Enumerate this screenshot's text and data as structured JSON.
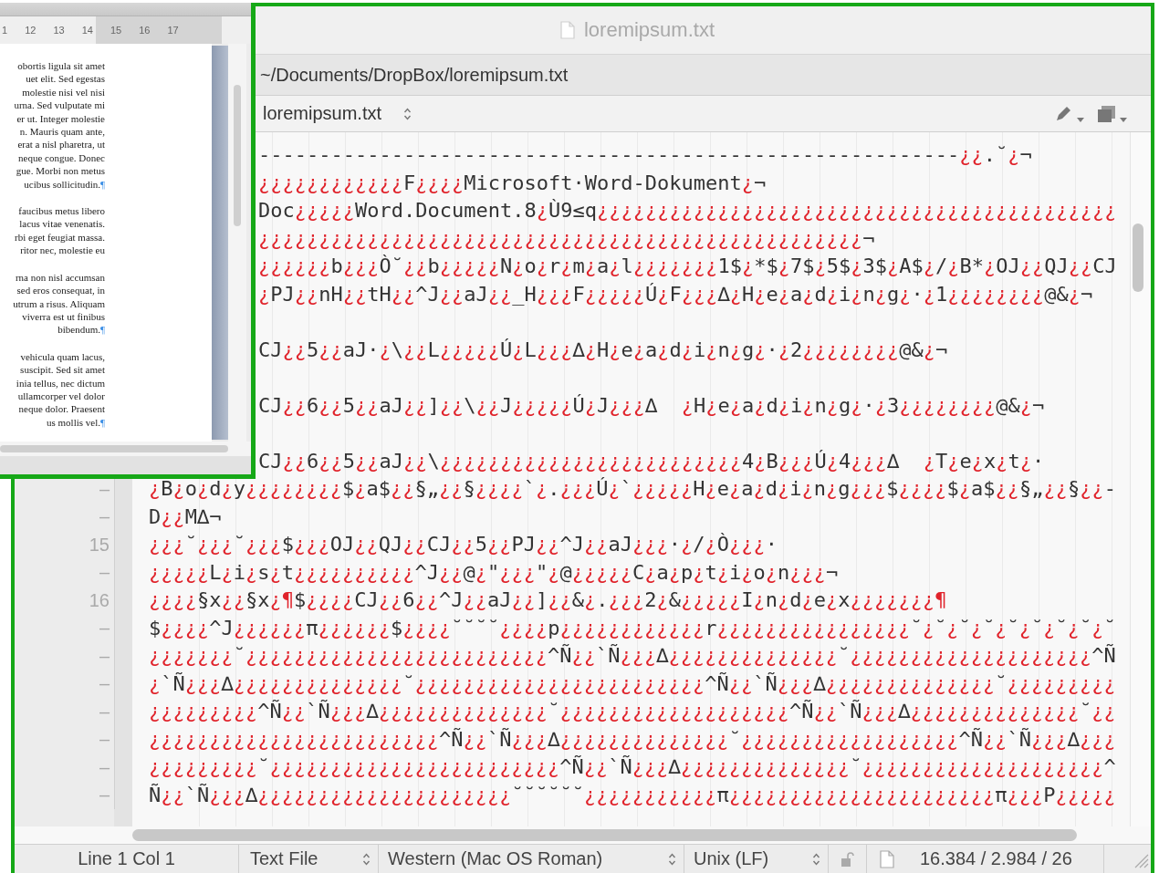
{
  "word_window": {
    "ruler_numbers": [
      "1",
      "12",
      "13",
      "14",
      "15",
      "16",
      "17"
    ],
    "paragraphs": [
      {
        "lines": [
          "obortis ligula sit amet",
          "uet elit. Sed egestas",
          "molestie nisi vel nisi",
          "urna. Sed vulputate mi",
          "er ut. Integer molestie",
          "n. Mauris quam ante,",
          "erat a nisl pharetra, ut",
          "neque congue. Donec",
          "gue. Morbi non metus",
          "ucibus sollicitudin."
        ],
        "end_mark": "¶"
      },
      {
        "lines": [
          "faucibus metus libero",
          "lacus vitae venenatis.",
          "rbi eget feugiat massa.",
          "ritor nec, molestie eu"
        ]
      },
      {
        "lines": [
          "rna non nisl accumsan",
          "sed eros consequat, in",
          "utrum a risus. Aliquam",
          "viverra est ut finibus",
          "bibendum."
        ],
        "end_mark": "¶"
      },
      {
        "lines": [
          "vehicula quam lacus,",
          "suscipit. Sed sit amet",
          "inia tellus, nec dictum",
          "ullamcorper vel dolor",
          "neque dolor. Praesent",
          "us mollis vel."
        ],
        "end_mark": "¶"
      }
    ]
  },
  "editor": {
    "title": "loremipsum.txt",
    "path": "~/Documents/DropBox/loremipsum.txt",
    "document_popup": "loremipsum.txt",
    "lines_under_window": [
      {
        "kind": "text_first",
        "runs": [
          "----------------------------------------------------------",
          "¿¿",
          ".˘",
          "¿",
          "¬"
        ]
      },
      {
        "kind": "invalid_first",
        "runs": [
          "¿¿¿¿¿¿¿¿¿¿¿¿",
          "F",
          "¿¿¿¿",
          "Microsoft·Word-Dokument",
          "¿",
          "¬"
        ]
      },
      {
        "kind": "text_first",
        "runs": [
          "Doc",
          "¿¿¿¿¿",
          "Word.Document.8",
          "¿",
          "Ù9≤q",
          "¿¿¿¿¿¿¿¿¿¿¿¿¿¿¿¿¿¿¿¿¿¿¿¿¿¿¿¿¿¿¿¿¿¿¿¿¿¿¿¿¿¿¿"
        ]
      },
      {
        "kind": "invalid_first",
        "runs": [
          "¿¿¿¿¿¿¿¿¿¿¿¿¿¿¿¿¿¿¿¿¿¿¿¿¿¿¿¿¿¿¿¿¿¿¿¿¿¿¿¿¿¿¿¿¿¿¿¿¿¿",
          "¬"
        ]
      },
      {
        "kind": "invalid_first",
        "runs": [
          "¿¿¿¿¿¿",
          "b",
          "¿¿¿",
          "Ò˘",
          "¿¿",
          "b",
          "¿¿¿¿¿",
          "N",
          "¿",
          "o",
          "¿",
          "r",
          "¿",
          "m",
          "¿",
          "a",
          "¿",
          "l",
          "¿¿¿¿¿¿¿",
          "1$",
          "¿",
          "*$",
          "¿",
          "7$",
          "¿",
          "5$",
          "¿",
          "3$",
          "¿",
          "A$",
          "¿",
          "/",
          "¿",
          "B*",
          "¿",
          "OJ",
          "¿¿",
          "QJ",
          "¿¿",
          "CJ"
        ]
      },
      {
        "kind": "invalid_first",
        "runs": [
          "¿",
          "PJ",
          "¿¿",
          "nH",
          "¿¿",
          "tH",
          "¿¿",
          "^J",
          "¿¿",
          "aJ",
          "¿¿",
          "_H",
          "¿¿¿",
          "F",
          "¿¿¿¿¿",
          "Ú",
          "¿",
          "F",
          "¿¿¿",
          "∆",
          "¿",
          "H",
          "¿",
          "e",
          "¿",
          "a",
          "¿",
          "d",
          "¿",
          "i",
          "¿",
          "n",
          "¿",
          "g",
          "¿",
          "·",
          "¿",
          "1",
          "¿¿¿¿¿¿¿¿",
          "@&",
          "¿",
          "¬"
        ]
      },
      {
        "kind": "text_first",
        "blank_line_before": true,
        "runs": [
          "CJ",
          "¿¿",
          "5",
          "¿¿",
          "aJ·",
          "¿",
          "\\",
          "¿¿",
          "L",
          "¿¿¿¿¿",
          "Ú",
          "¿",
          "L",
          "¿¿¿",
          "∆",
          "¿",
          "H",
          "¿",
          "e",
          "¿",
          "a",
          "¿",
          "d",
          "¿",
          "i",
          "¿",
          "n",
          "¿",
          "g",
          "¿",
          "·",
          "¿",
          "2",
          "¿¿¿¿¿¿¿¿",
          "@&",
          "¿",
          "¬"
        ]
      },
      {
        "kind": "text_first",
        "blank_line_before": true,
        "runs": [
          "CJ",
          "¿¿",
          "6",
          "¿¿",
          "5",
          "¿¿",
          "aJ",
          "¿¿",
          "]",
          "¿¿",
          "\\",
          "¿¿",
          "J",
          "¿¿¿¿¿",
          "Ú",
          "¿",
          "J",
          "¿¿¿",
          "∆  ",
          "¿",
          "H",
          "¿",
          "e",
          "¿",
          "a",
          "¿",
          "d",
          "¿",
          "i",
          "¿",
          "n",
          "¿",
          "g",
          "¿",
          "·",
          "¿",
          "3",
          "¿¿¿¿¿¿¿¿",
          "@&",
          "¿",
          "¬"
        ]
      },
      {
        "kind": "text_first",
        "blank_line_before": true,
        "runs": [
          "CJ",
          "¿¿",
          "6",
          "¿¿",
          "5",
          "¿¿",
          "aJ",
          "¿¿",
          "\\",
          "¿¿¿¿¿¿¿¿¿¿¿¿¿¿¿¿¿¿¿¿¿¿¿¿¿",
          "4",
          "¿",
          "B",
          "¿¿¿",
          "Ú",
          "¿",
          "4",
          "¿¿¿",
          "∆  ",
          "¿",
          "T",
          "¿",
          "e",
          "¿",
          "x",
          "¿",
          "t",
          "¿",
          "·"
        ]
      }
    ],
    "lines": [
      {
        "gutter": "–",
        "kind": "invalid_first",
        "runs": [
          "¿",
          "B",
          "¿",
          "o",
          "¿",
          "d",
          "¿",
          "y",
          "¿¿¿¿¿¿¿¿",
          "$",
          "¿",
          "a$",
          "¿¿",
          "§„",
          "¿¿",
          "§",
          "¿¿¿¿",
          "`",
          "¿",
          ".",
          "¿¿¿",
          "Ú",
          "¿",
          "`",
          "¿¿¿¿¿",
          "H",
          "¿",
          "e",
          "¿",
          "a",
          "¿",
          "d",
          "¿",
          "i",
          "¿",
          "n",
          "¿",
          "g",
          "¿¿¿",
          "$",
          "¿¿¿¿",
          "$",
          "¿",
          "a$",
          "¿¿",
          "§„",
          "¿¿",
          "§",
          "¿¿",
          "-"
        ]
      },
      {
        "gutter": "–",
        "kind": "text_first",
        "runs": [
          "D",
          "¿¿",
          "M∆¬"
        ]
      },
      {
        "gutter": "15",
        "kind": "invalid_first",
        "runs": [
          "¿¿¿",
          "˘",
          "¿¿¿",
          "˘",
          "¿¿¿",
          "$",
          "¿¿¿",
          "OJ",
          "¿¿",
          "QJ",
          "¿¿",
          "CJ",
          "¿¿",
          "5",
          "¿¿",
          "PJ",
          "¿¿",
          "^J",
          "¿¿",
          "aJ",
          "¿¿¿",
          "·",
          "¿",
          "/",
          "¿",
          "Ò",
          "¿¿¿",
          "·"
        ]
      },
      {
        "gutter": "–",
        "kind": "invalid_first",
        "runs": [
          "¿¿¿¿¿",
          "L",
          "¿",
          "i",
          "¿",
          "s",
          "¿",
          "t",
          "¿¿¿¿¿¿¿¿¿¿",
          "^J",
          "¿¿",
          "@",
          "¿",
          "\"",
          "¿¿¿",
          "\"",
          "¿",
          "@",
          "¿¿¿¿¿",
          "C",
          "¿",
          "a",
          "¿",
          "p",
          "¿",
          "t",
          "¿",
          "i",
          "¿",
          "o",
          "¿",
          "n",
          "¿¿¿",
          "¬"
        ]
      },
      {
        "gutter": "16",
        "kind": "invalid_first",
        "runs": [
          "¿¿¿¿",
          "§x",
          "¿¿",
          "§x",
          "¿¶",
          "$",
          "¿¿¿¿",
          "CJ",
          "¿¿",
          "6",
          "¿¿",
          "^J",
          "¿¿",
          "aJ",
          "¿¿",
          "]",
          "¿¿",
          "&",
          "¿",
          ".",
          "¿¿¿",
          "2",
          "¿",
          "&",
          "¿¿¿¿¿",
          "I",
          "¿",
          "n",
          "¿",
          "d",
          "¿",
          "e",
          "¿",
          "x",
          "¿¿¿¿¿¿¿¶"
        ]
      },
      {
        "gutter": "–",
        "kind": "text_first",
        "runs": [
          "$",
          "¿¿¿¿",
          "^J",
          "¿¿¿¿¿¿",
          "π",
          "¿¿¿¿¿¿",
          "$",
          "¿¿¿¿",
          "˘˘˘˘",
          "¿¿¿¿",
          "p",
          "¿¿¿¿¿¿¿¿¿¿¿¿",
          "r",
          "¿¿¿¿¿¿¿¿¿¿¿¿¿¿¿¿",
          "˘",
          "¿",
          "˘",
          "¿",
          "˘",
          "¿",
          "˘",
          "¿",
          "˘",
          "¿",
          "˘",
          "¿",
          "˘",
          "¿",
          "˘",
          "¿",
          "˘"
        ]
      },
      {
        "gutter": "–",
        "kind": "invalid_first",
        "runs": [
          "¿¿¿¿¿¿¿",
          "˘",
          "¿¿¿¿¿¿¿¿¿¿¿¿¿¿¿¿¿¿¿¿¿¿¿¿¿",
          "^Ñ",
          "¿¿",
          "`Ñ",
          "¿¿¿",
          "∆",
          "¿¿¿¿¿¿¿¿¿¿¿¿¿¿",
          "˘",
          "¿¿¿¿¿¿¿¿¿¿¿¿¿¿¿¿¿¿¿¿",
          "^Ñ"
        ]
      },
      {
        "gutter": "–",
        "kind": "invalid_first",
        "runs": [
          "¿",
          "`Ñ",
          "¿¿¿",
          "∆",
          "¿¿¿¿¿¿¿¿¿¿¿¿¿¿",
          "˘",
          "¿¿¿¿¿¿¿¿¿¿¿¿¿¿¿¿¿¿¿¿¿¿¿¿",
          "^Ñ",
          "¿¿",
          "`Ñ",
          "¿¿¿",
          "∆",
          "¿¿¿¿¿¿¿¿¿¿¿¿¿¿",
          "˘",
          "¿¿¿¿¿¿¿¿¿"
        ]
      },
      {
        "gutter": "–",
        "kind": "invalid_first",
        "runs": [
          "¿¿¿¿¿¿¿¿¿",
          "^Ñ",
          "¿¿",
          "`Ñ",
          "¿¿¿",
          "∆",
          "¿¿¿¿¿¿¿¿¿¿¿¿¿¿",
          "˘",
          "¿¿¿¿¿¿¿¿¿¿¿¿¿¿¿¿¿¿¿",
          "^Ñ",
          "¿¿",
          "`Ñ",
          "¿¿¿",
          "∆",
          "¿¿¿¿¿¿¿¿¿¿¿¿¿¿",
          "˘",
          "¿¿"
        ]
      },
      {
        "gutter": "–",
        "kind": "invalid_first",
        "runs": [
          "¿¿¿¿¿¿¿¿¿¿¿¿¿¿¿¿¿¿¿¿¿¿¿¿",
          "^Ñ",
          "¿¿",
          "`Ñ",
          "¿¿¿",
          "∆",
          "¿¿¿¿¿¿¿¿¿¿¿¿¿¿",
          "˘",
          "¿¿¿¿¿¿¿¿¿¿¿¿¿¿¿¿¿¿",
          "^Ñ",
          "¿¿",
          "`Ñ",
          "¿¿¿",
          "∆",
          "¿¿¿"
        ]
      },
      {
        "gutter": "–",
        "kind": "invalid_first",
        "runs": [
          "¿¿¿¿¿¿¿¿¿",
          "˘",
          "¿¿¿¿¿¿¿¿¿¿¿¿¿¿¿¿¿¿¿¿¿¿¿¿",
          "^Ñ",
          "¿¿",
          "`Ñ",
          "¿¿¿",
          "∆",
          "¿¿¿¿¿¿¿¿¿¿¿¿¿¿",
          "˘",
          "¿¿¿¿¿¿¿¿¿¿¿¿¿¿¿¿¿¿¿¿",
          "^"
        ]
      },
      {
        "gutter": "–",
        "kind": "text_first",
        "runs": [
          "Ñ",
          "¿¿",
          "`Ñ",
          "¿¿¿",
          "∆",
          "¿¿¿¿¿¿¿¿¿¿¿¿¿¿¿¿¿¿¿¿¿",
          "˘˘˘˘˘˘",
          "¿¿¿¿¿¿¿¿¿¿¿",
          "π",
          "¿¿¿¿¿¿¿¿¿¿¿¿¿¿¿¿¿¿¿¿¿¿",
          "π",
          "¿¿¿",
          "P",
          "¿¿¿¿¿"
        ]
      }
    ]
  },
  "status_bar": {
    "position": "Line 1 Col 1",
    "file_type": "Text File",
    "encoding": "Western (Mac OS Roman)",
    "line_endings": "Unix (LF)",
    "counts": "16.384 / 2.984 / 26"
  }
}
